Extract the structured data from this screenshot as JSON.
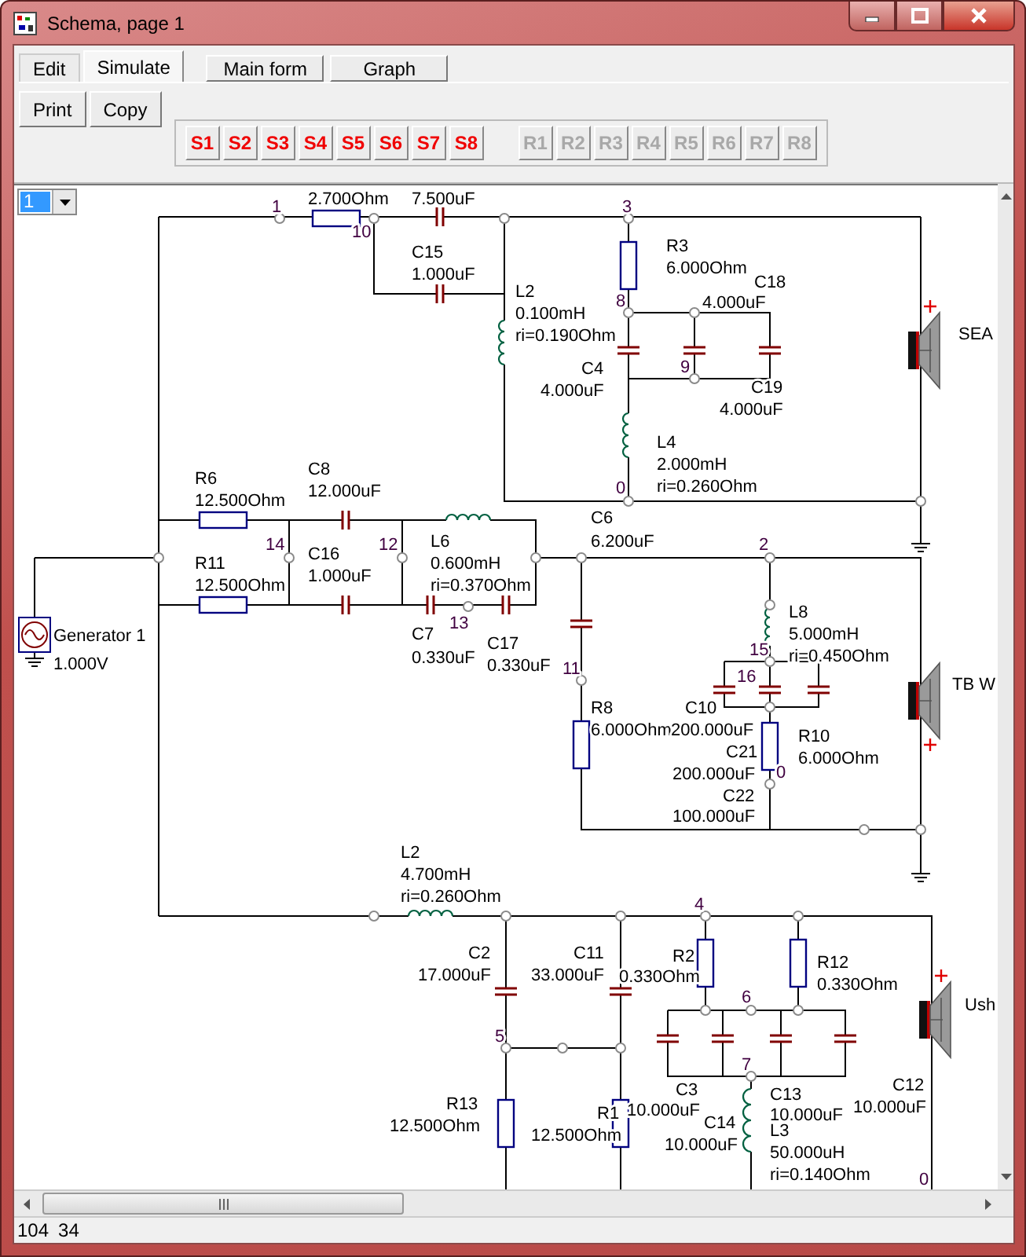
{
  "window": {
    "title": "Schema, page 1"
  },
  "tabs": [
    {
      "label": "Edit",
      "selected": false
    },
    {
      "label": "Simulate",
      "selected": true
    }
  ],
  "view_buttons": [
    "Main form",
    "Graph"
  ],
  "action_buttons": [
    "Print",
    "Copy"
  ],
  "step_buttons": [
    {
      "label": "S1",
      "disabled": false
    },
    {
      "label": "S2",
      "disabled": false
    },
    {
      "label": "S3",
      "disabled": false
    },
    {
      "label": "S4",
      "disabled": false
    },
    {
      "label": "S5",
      "disabled": false
    },
    {
      "label": "S6",
      "disabled": false
    },
    {
      "label": "S7",
      "disabled": false
    },
    {
      "label": "S8",
      "disabled": false
    },
    {
      "label": "R1",
      "disabled": true
    },
    {
      "label": "R2",
      "disabled": true
    },
    {
      "label": "R3",
      "disabled": true
    },
    {
      "label": "R4",
      "disabled": true
    },
    {
      "label": "R5",
      "disabled": true
    },
    {
      "label": "R6",
      "disabled": true
    },
    {
      "label": "R7",
      "disabled": true
    },
    {
      "label": "R8",
      "disabled": true
    }
  ],
  "page_select": {
    "value": "1"
  },
  "schematic": {
    "components": [
      {
        "value": "2.700Ohm"
      },
      {
        "value": "7.500uF"
      },
      {
        "name": "C15",
        "value": "1.000uF"
      },
      {
        "name": "L2",
        "value": "0.100mH",
        "ri": "ri=0.190Ohm"
      },
      {
        "name": "R3",
        "value": "6.000Ohm"
      },
      {
        "name": "C18",
        "value": "4.000uF"
      },
      {
        "name": "C4",
        "value": "4.000uF"
      },
      {
        "name": "C19",
        "value": "4.000uF"
      },
      {
        "name": "L4",
        "value": "2.000mH",
        "ri": "ri=0.260Ohm"
      },
      {
        "name": "R6",
        "value": "12.500Ohm"
      },
      {
        "name": "C8",
        "value": "12.000uF"
      },
      {
        "name": "R11",
        "value": "12.500Ohm"
      },
      {
        "name": "C16",
        "value": "1.000uF"
      },
      {
        "name": "L6",
        "value": "0.600mH",
        "ri": "ri=0.370Ohm"
      },
      {
        "name": "C6",
        "value": "6.200uF"
      },
      {
        "name": "C7",
        "value": "0.330uF"
      },
      {
        "name": "C17",
        "value": "0.330uF"
      },
      {
        "name": "L8",
        "value": "5.000mH",
        "ri": "ri=0.450Ohm"
      },
      {
        "name": "R8",
        "value": "6.000Ohm"
      },
      {
        "name": "C10",
        "value": "200.000uF"
      },
      {
        "name": "R10",
        "value": "6.000Ohm"
      },
      {
        "name": "C21",
        "value": "200.000uF"
      },
      {
        "name": "C22",
        "value": "100.000uF"
      },
      {
        "name": "L2",
        "value": "4.700mH",
        "ri": "ri=0.260Ohm"
      },
      {
        "name": "C2",
        "value": "17.000uF"
      },
      {
        "name": "C11",
        "value": "33.000uF"
      },
      {
        "name": "R2",
        "value": "0.330Ohm"
      },
      {
        "name": "R12",
        "value": "0.330Ohm"
      },
      {
        "name": "C3",
        "value": "10.000uF"
      },
      {
        "name": "C13",
        "value": "10.000uF"
      },
      {
        "name": "C12",
        "value": "10.000uF"
      },
      {
        "name": "R13",
        "value": "12.500Ohm"
      },
      {
        "name": "R1",
        "value": "12.500Ohm"
      },
      {
        "name": "C14",
        "value": "10.000uF"
      },
      {
        "name": "L3",
        "value": "50.000uH",
        "ri": "ri=0.140Ohm"
      }
    ],
    "node_numbers": [
      "1",
      "10",
      "3",
      "8",
      "9",
      "0",
      "14",
      "12",
      "13",
      "2",
      "11",
      "15",
      "16",
      "0",
      "4",
      "6",
      "5",
      "7",
      "0"
    ],
    "speakers": [
      {
        "name": "SEA"
      },
      {
        "name": "TB W"
      },
      {
        "name": "Ush"
      }
    ],
    "generator": {
      "name": "Generator 1",
      "value": "1.000V"
    }
  },
  "status_bar": [
    "104",
    "34"
  ]
}
